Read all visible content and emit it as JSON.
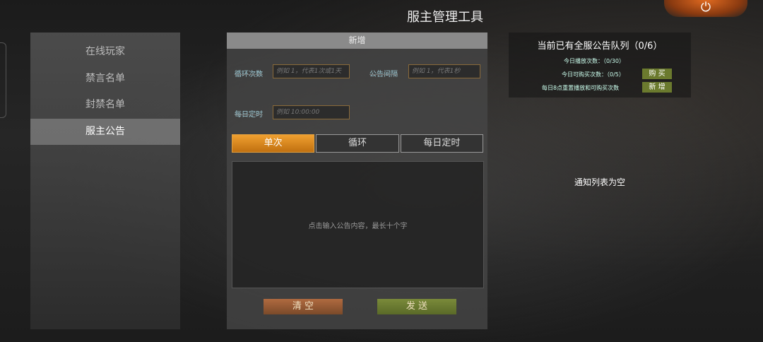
{
  "header": {
    "title": "服主管理工具"
  },
  "sidebar": {
    "items": [
      {
        "label": "在线玩家"
      },
      {
        "label": "禁言名单"
      },
      {
        "label": "封禁名单"
      },
      {
        "label": "服主公告"
      }
    ]
  },
  "panel": {
    "title": "新增",
    "loop_count_label": "循环次数",
    "loop_count_placeholder": "例如 1，代表1次或1天",
    "interval_label": "公告间隔",
    "interval_placeholder": "例如 1，代表1秒",
    "daily_time_label": "每日定时",
    "daily_time_placeholder": "例如 10:00:00",
    "tabs": [
      {
        "label": "单次"
      },
      {
        "label": "循环"
      },
      {
        "label": "每日定时"
      }
    ],
    "content_placeholder": "点击输入公告内容，最长十个字",
    "clear_label": "清 空",
    "send_label": "发 送"
  },
  "info": {
    "title": "当前已有全服公告队列（0/6）",
    "today_plays": "今日播放次数：（0/30）",
    "today_buyable": "今日可购买次数：（0/5）",
    "buy_label": "购 买",
    "reset_note": "每日8点重置播放和可购买次数",
    "add_label": "新 增"
  },
  "notice": {
    "empty": "通知列表为空"
  },
  "colors": {
    "accent": "#e08a20",
    "send": "#6b7a2e",
    "clear": "#9a5a35"
  }
}
